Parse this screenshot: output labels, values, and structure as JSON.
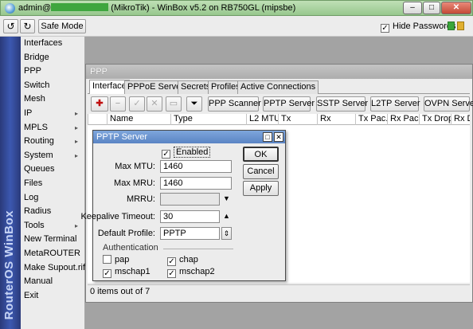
{
  "window": {
    "title_prefix": "admin@",
    "title_suffix": "(MikroTik) - WinBox v5.2 on RB750GL (mipsbe)",
    "minimize": "–",
    "maximize": "□",
    "close": "✕"
  },
  "toolbar": {
    "undo_icon": "↺",
    "redo_icon": "↻",
    "safe_mode": "Safe Mode",
    "hide_passwords": "Hide Passwords",
    "hide_passwords_checked": "✓"
  },
  "brand": "RouterOS WinBox",
  "menu": [
    {
      "label": "Interfaces"
    },
    {
      "label": "Bridge"
    },
    {
      "label": "PPP"
    },
    {
      "label": "Switch"
    },
    {
      "label": "Mesh"
    },
    {
      "label": "IP",
      "arrow": "▸"
    },
    {
      "label": "MPLS",
      "arrow": "▸"
    },
    {
      "label": "Routing",
      "arrow": "▸"
    },
    {
      "label": "System",
      "arrow": "▸"
    },
    {
      "label": "Queues"
    },
    {
      "label": "Files"
    },
    {
      "label": "Log"
    },
    {
      "label": "Radius"
    },
    {
      "label": "Tools",
      "arrow": "▸"
    },
    {
      "label": "New Terminal"
    },
    {
      "label": "MetaROUTER"
    },
    {
      "label": "Make Supout.rif"
    },
    {
      "label": "Manual"
    },
    {
      "label": "Exit"
    }
  ],
  "ppp": {
    "title": "PPP",
    "tabs": [
      "Interface",
      "PPPoE Servers",
      "Secrets",
      "Profiles",
      "Active Connections"
    ],
    "tools": {
      "add": "✚",
      "remove": "−",
      "enable": "✓",
      "disable": "✕",
      "comment": "▭",
      "filter": "⏷",
      "ppp_scanner": "PPP Scanner",
      "pptp_server": "PPTP Server",
      "sstp_server": "SSTP Server",
      "l2tp_server": "L2TP Server",
      "ovpn_server": "OVPN Server"
    },
    "columns": [
      "Name",
      "Type",
      "L2 MTU",
      "Tx",
      "Rx",
      "Tx Pac...",
      "Rx Pac...",
      "Tx Drops",
      "Rx Dr"
    ],
    "status": "0 items out of 7"
  },
  "pptp": {
    "title": "PPTP Server",
    "enabled_label": "Enabled",
    "enabled_check": "✓",
    "max_mtu_label": "Max MTU:",
    "max_mtu": "1460",
    "max_mru_label": "Max MRU:",
    "max_mru": "1460",
    "mrru_label": "MRRU:",
    "mrru": "",
    "keepalive_label": "Keepalive Timeout:",
    "keepalive": "30",
    "profile_label": "Default Profile:",
    "profile": "PPTP",
    "auth_label": "Authentication",
    "auth": [
      {
        "label": "pap",
        "check": ""
      },
      {
        "label": "chap",
        "check": "✓"
      },
      {
        "label": "mschap1",
        "check": "✓"
      },
      {
        "label": "mschap2",
        "check": "✓"
      }
    ],
    "ok": "OK",
    "cancel": "Cancel",
    "apply": "Apply"
  }
}
